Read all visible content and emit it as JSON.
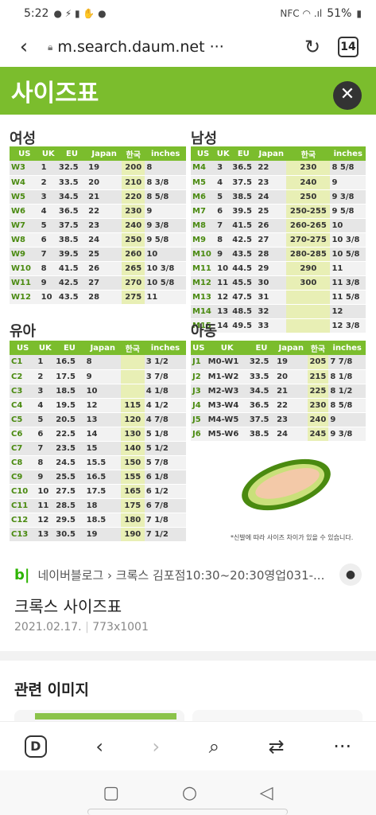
{
  "status": {
    "time": "5:22",
    "battery": "51%"
  },
  "browser": {
    "url": "m.search.daum.net",
    "more": "···",
    "tab_count": "14"
  },
  "image": {
    "title": "사이즈표",
    "female": {
      "title": "여성",
      "headers": [
        "US",
        "UK",
        "EU",
        "Japan",
        "한국",
        "inches"
      ],
      "rows": [
        [
          "W3",
          "1",
          "32.5",
          "19",
          "200",
          "8"
        ],
        [
          "W4",
          "2",
          "33.5",
          "20",
          "210",
          "8 3/8"
        ],
        [
          "W5",
          "3",
          "34.5",
          "21",
          "220",
          "8 5/8"
        ],
        [
          "W6",
          "4",
          "36.5",
          "22",
          "230",
          "9"
        ],
        [
          "W7",
          "5",
          "37.5",
          "23",
          "240",
          "9 3/8"
        ],
        [
          "W8",
          "6",
          "38.5",
          "24",
          "250",
          "9 5/8"
        ],
        [
          "W9",
          "7",
          "39.5",
          "25",
          "260",
          "10"
        ],
        [
          "W10",
          "8",
          "41.5",
          "26",
          "265",
          "10 3/8"
        ],
        [
          "W11",
          "9",
          "42.5",
          "27",
          "270",
          "10 5/8"
        ],
        [
          "W12",
          "10",
          "43.5",
          "28",
          "275",
          "11"
        ]
      ]
    },
    "male": {
      "title": "남성",
      "headers": [
        "US",
        "UK",
        "EU",
        "Japan",
        "한국",
        "inches"
      ],
      "rows": [
        [
          "M4",
          "3",
          "36.5",
          "22",
          "230",
          "8 5/8"
        ],
        [
          "M5",
          "4",
          "37.5",
          "23",
          "240",
          "9"
        ],
        [
          "M6",
          "5",
          "38.5",
          "24",
          "250",
          "9 3/8"
        ],
        [
          "M7",
          "6",
          "39.5",
          "25",
          "250-255",
          "9 5/8"
        ],
        [
          "M8",
          "7",
          "41.5",
          "26",
          "260-265",
          "10"
        ],
        [
          "M9",
          "8",
          "42.5",
          "27",
          "270-275",
          "10 3/8"
        ],
        [
          "M10",
          "9",
          "43.5",
          "28",
          "280-285",
          "10 5/8"
        ],
        [
          "M11",
          "10",
          "44.5",
          "29",
          "290",
          "11"
        ],
        [
          "M12",
          "11",
          "45.5",
          "30",
          "300",
          "11 3/8"
        ],
        [
          "M13",
          "12",
          "47.5",
          "31",
          "",
          "11 5/8"
        ],
        [
          "M14",
          "13",
          "48.5",
          "32",
          "",
          "12"
        ],
        [
          "M15",
          "14",
          "49.5",
          "33",
          "",
          "12 3/8"
        ]
      ]
    },
    "infant": {
      "title": "유아",
      "headers": [
        "US",
        "UK",
        "EU",
        "Japan",
        "한국",
        "inches"
      ],
      "rows": [
        [
          "C1",
          "1",
          "16.5",
          "8",
          "",
          "3 1/2"
        ],
        [
          "C2",
          "2",
          "17.5",
          "9",
          "",
          "3 7/8"
        ],
        [
          "C3",
          "3",
          "18.5",
          "10",
          "",
          "4 1/8"
        ],
        [
          "C4",
          "4",
          "19.5",
          "12",
          "115",
          "4 1/2"
        ],
        [
          "C5",
          "5",
          "20.5",
          "13",
          "120",
          "4 7/8"
        ],
        [
          "C6",
          "6",
          "22.5",
          "14",
          "130",
          "5 1/8"
        ],
        [
          "C7",
          "7",
          "23.5",
          "15",
          "140",
          "5 1/2"
        ],
        [
          "C8",
          "8",
          "24.5",
          "15.5",
          "150",
          "5 7/8"
        ],
        [
          "C9",
          "9",
          "25.5",
          "16.5",
          "155",
          "6 1/8"
        ],
        [
          "C10",
          "10",
          "27.5",
          "17.5",
          "165",
          "6 1/2"
        ],
        [
          "C11",
          "11",
          "28.5",
          "18",
          "175",
          "6 7/8"
        ],
        [
          "C12",
          "12",
          "29.5",
          "18.5",
          "180",
          "7 1/8"
        ],
        [
          "C13",
          "13",
          "30.5",
          "19",
          "190",
          "7 1/2"
        ]
      ]
    },
    "kids": {
      "title": "아동",
      "headers": [
        "US",
        "UK",
        "EU",
        "Japan",
        "한국",
        "inches"
      ],
      "rows": [
        [
          "J1",
          "M0-W1",
          "32.5",
          "19",
          "205",
          "7 7/8"
        ],
        [
          "J2",
          "M1-W2",
          "33.5",
          "20",
          "215",
          "8 1/8"
        ],
        [
          "J3",
          "M2-W3",
          "34.5",
          "21",
          "225",
          "8 1/2"
        ],
        [
          "J4",
          "M3-W4",
          "36.5",
          "22",
          "230",
          "8 5/8"
        ],
        [
          "J5",
          "M4-W5",
          "37.5",
          "23",
          "240",
          "9"
        ],
        [
          "J6",
          "M5-W6",
          "38.5",
          "24",
          "245",
          "9 3/8"
        ]
      ]
    },
    "footnote": "*신발에 따라 사이즈 차이가 있을 수 있습니다."
  },
  "result": {
    "source_logo": "b|",
    "source": "네이버블로그 › 크록스 김포점10:30~20:30영업031-...",
    "title": "크록스 사이즈표",
    "date": "2021.02.17.",
    "dimensions": "773x1001"
  },
  "related": {
    "title": "관련 이미지"
  },
  "colors": {
    "accent_green": "#7bbd2d",
    "highlight": "#e8efb5"
  },
  "icons": [
    "back-icon",
    "lock-icon",
    "reload-icon",
    "close-icon",
    "chat-icon",
    "daum-icon",
    "forward-icon",
    "search-icon",
    "share-icon",
    "more-icon"
  ]
}
